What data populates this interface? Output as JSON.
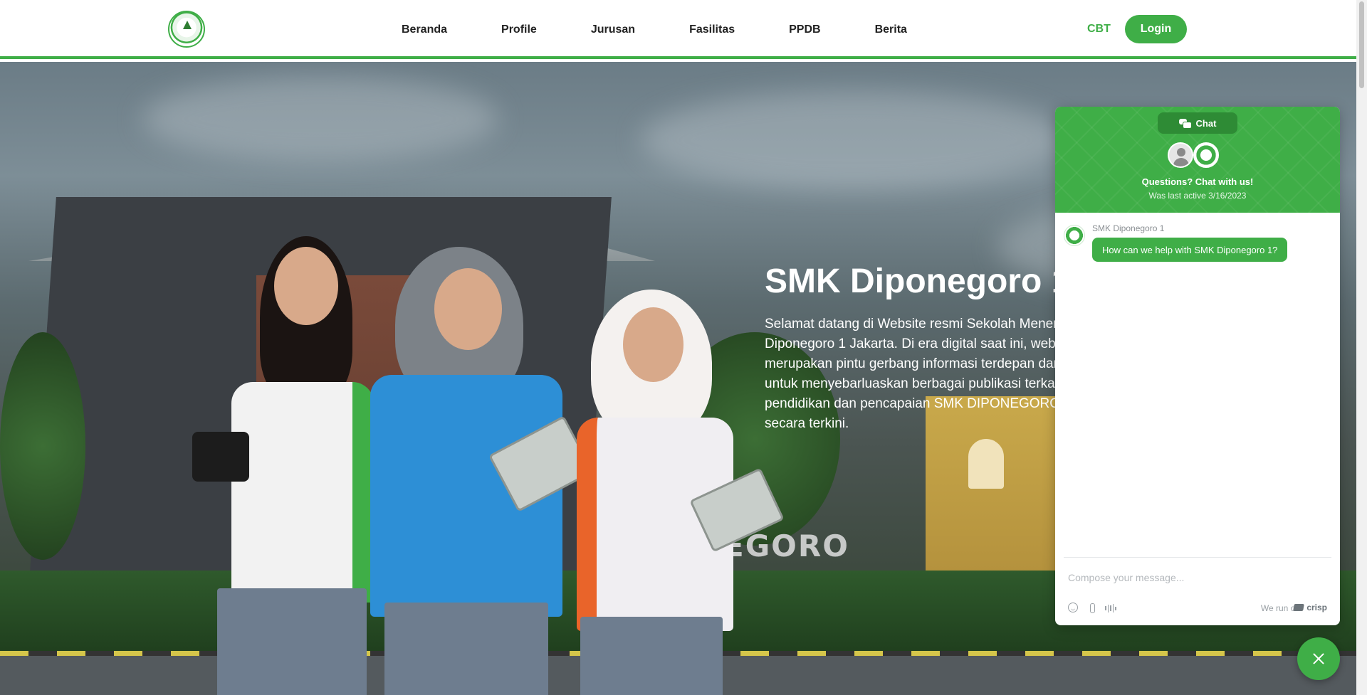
{
  "header": {
    "nav": [
      "Beranda",
      "Profile",
      "Jurusan",
      "Fasilitas",
      "PPDB",
      "Berita"
    ],
    "cbt_label": "CBT",
    "login_label": "Login",
    "accent_color": "#3fae47"
  },
  "hero": {
    "title": "SMK Diponegoro 1",
    "description": "Selamat datang di Website resmi Sekolah Menengah Kejuruan Diponegoro 1 Jakarta. Di era digital saat ini, website kami merupakan pintu gerbang informasi terdepan dan juga berfungsi untuk menyebarluaskan berbagai publikasi terkait kegiatan pendidikan dan pencapaian SMK DIPONEGORO 1 Jakarta secara terkini.",
    "sign_text": "EGORO"
  },
  "chat": {
    "tab_label": "Chat",
    "question": "Questions? Chat with us!",
    "last_active": "Was last active 3/16/2023",
    "sender": "SMK Diponegoro 1",
    "message": "How can we help with SMK Diponegoro 1?",
    "compose_placeholder": "Compose your message...",
    "run_on": "We run on",
    "brand": "crisp"
  }
}
